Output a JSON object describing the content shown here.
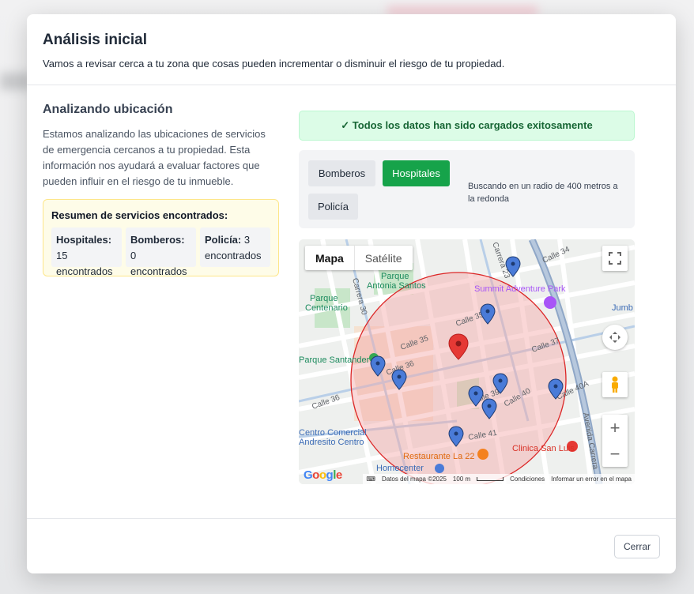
{
  "modal": {
    "title": "Análisis inicial",
    "subtitle": "Vamos a revisar cerca a tu zona que cosas pueden incrementar o disminuir el riesgo de tu propiedad."
  },
  "analysis": {
    "title": "Analizando ubicación",
    "description": "Estamos analizando las ubicaciones de servicios de emergencia cercanos a tu propiedad. Esta información nos ayudará a evaluar factores que pueden influir en el riesgo de tu inmueble."
  },
  "summary": {
    "title": "Resumen de servicios encontrados:",
    "items": [
      {
        "label": "Hospitales:",
        "value": "15",
        "suffix": "encontrados"
      },
      {
        "label": "Bomberos:",
        "value": "0",
        "suffix": "encontrados"
      },
      {
        "label": "Policía:",
        "value": "3",
        "suffix": "encontrados"
      }
    ]
  },
  "status": {
    "success_message": "✓ Todos los datos han sido cargados exitosamente",
    "success_color": "#166534"
  },
  "filters": {
    "buttons": [
      {
        "label": "Bomberos",
        "active": false
      },
      {
        "label": "Hospitales",
        "active": true
      },
      {
        "label": "Policía",
        "active": false
      }
    ],
    "radius_note": "Buscando en un radio de 400 metros a la redonda",
    "active_color": "#16a34a"
  },
  "map": {
    "type_buttons": {
      "map": "Mapa",
      "satellite": "Satélite"
    },
    "street_labels": [
      "Calle 34",
      "Calle 35",
      "Calle 36",
      "Calle 37",
      "Calle 39",
      "Calle 40",
      "Calle 40A",
      "Calle 41",
      "Calle 36",
      "Calle 35",
      "Carrera 23",
      "Carrera 30",
      "Calle 36"
    ],
    "place_labels": {
      "parque_antonia": "Parque Antonia Santos",
      "parque_centenario": "Parque Centenario",
      "summit": "Summit Adventure Park",
      "parque_santander": "Parque Santander",
      "centro_comercial": "Centro Comercial Andresito Centro",
      "restaurante": "Restaurante La 22",
      "clinica": "Clinica San Luis",
      "homecenter": "Homecenter",
      "avenida": "Avenida Carrera",
      "jumbo": "Jumb"
    },
    "attribution": {
      "data": "Datos del mapa ©2025",
      "scale": "100 m",
      "terms": "Condiciones",
      "report": "Informar un error en el mapa"
    },
    "google": "Google",
    "circle_color": "#dc2626",
    "marker_color": "#4a7bd8",
    "center_marker_color": "#e53935"
  },
  "footer": {
    "close_label": "Cerrar"
  }
}
